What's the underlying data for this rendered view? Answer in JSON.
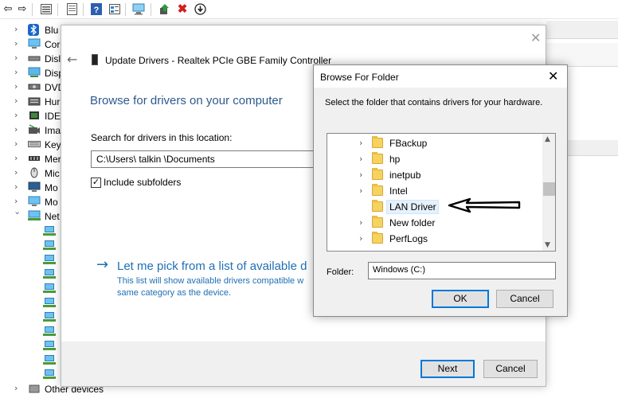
{
  "background_tree": {
    "items": [
      {
        "label": "Blu",
        "icon": "bluetooth-icon",
        "expanded": false
      },
      {
        "label": "Cor",
        "icon": "monitor-icon",
        "expanded": false
      },
      {
        "label": "Disl",
        "icon": "disk-drive-icon",
        "expanded": false
      },
      {
        "label": "Disp",
        "icon": "display-adapter-icon",
        "expanded": false
      },
      {
        "label": "DVD",
        "icon": "dvd-drive-icon",
        "expanded": false
      },
      {
        "label": "Hur",
        "icon": "hid-icon",
        "expanded": false
      },
      {
        "label": "IDE",
        "icon": "ide-controller-icon",
        "expanded": false
      },
      {
        "label": "Ima",
        "icon": "camera-icon",
        "expanded": false
      },
      {
        "label": "Key",
        "icon": "keyboard-icon",
        "expanded": false
      },
      {
        "label": "Mer",
        "icon": "memory-icon",
        "expanded": false
      },
      {
        "label": "Mic",
        "icon": "mouse-icon",
        "expanded": false
      },
      {
        "label": "Mo",
        "icon": "monitor-icon",
        "expanded": false
      },
      {
        "label": "Mo",
        "icon": "monitor-icon",
        "expanded": false
      },
      {
        "label": "Net",
        "icon": "network-adapter-icon",
        "expanded": true
      }
    ],
    "other_devices": "Other devices"
  },
  "wizard": {
    "title": "Update Drivers - Realtek PCIe GBE Family Controller",
    "heading": "Browse for drivers on your computer",
    "search_label": "Search for drivers in this location:",
    "path_value": "C:\\Users\\ talkin \\Documents",
    "include_subfolders_label": "Include subfolders",
    "include_subfolders_checked": true,
    "pick_link": "Let me pick from a list of available d",
    "pick_desc": "This list will show available drivers compatible w same category as the device.",
    "next_label": "Next",
    "cancel_label": "Cancel"
  },
  "browse": {
    "title": "Browse For Folder",
    "instructions": "Select the folder that contains drivers for your hardware.",
    "folders": [
      {
        "label": "FBackup",
        "expandable": true,
        "selected": false
      },
      {
        "label": "hp",
        "expandable": true,
        "selected": false
      },
      {
        "label": "inetpub",
        "expandable": true,
        "selected": false
      },
      {
        "label": "Intel",
        "expandable": true,
        "selected": false
      },
      {
        "label": "LAN Driver",
        "expandable": false,
        "selected": true
      },
      {
        "label": "New folder",
        "expandable": true,
        "selected": false
      },
      {
        "label": "PerfLogs",
        "expandable": true,
        "selected": false
      }
    ],
    "folder_label": "Folder:",
    "folder_value": "Windows (C:)",
    "ok_label": "OK",
    "cancel_label": "Cancel"
  },
  "colors": {
    "link_blue": "#1f6fb5",
    "heading_blue": "#2c5a8c",
    "selection": "#e5f1fb",
    "folder_yellow": "#f6d25e"
  }
}
